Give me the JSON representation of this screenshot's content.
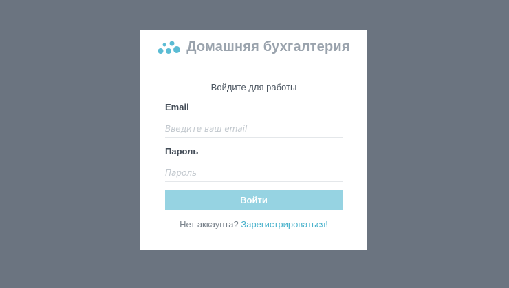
{
  "brand": {
    "title": "Домашняя бухгалтерия",
    "logo_icon": "dots-logo-icon",
    "logo_color": "#5bbcd4"
  },
  "login": {
    "subtitle": "Войдите для работы",
    "email_label": "Email",
    "email_placeholder": "Введите ваш email",
    "email_value": "",
    "password_label": "Пароль",
    "password_placeholder": "Пароль",
    "password_value": "",
    "submit_label": "Войти",
    "register_prompt": "Нет аккаунта?",
    "register_link": "Зарегистрироваться!"
  },
  "colors": {
    "background": "#6b7480",
    "button": "#96d3e2",
    "link": "#4bb3cc"
  }
}
